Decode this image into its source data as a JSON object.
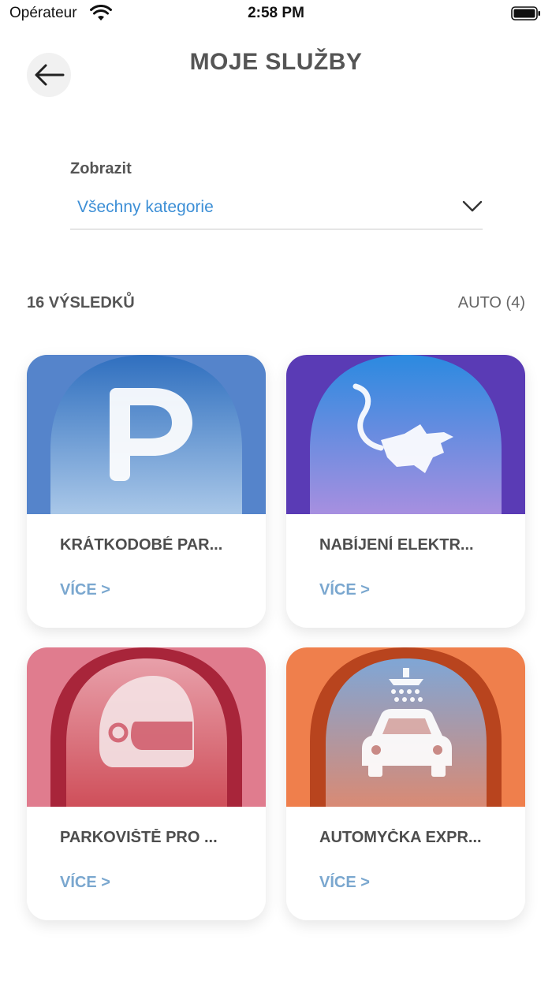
{
  "status": {
    "carrier": "Opérateur",
    "time": "2:58 PM"
  },
  "header": {
    "title": "MOJE SLUŽBY"
  },
  "filter": {
    "label": "Zobrazit",
    "value": "Všechny kategorie"
  },
  "results": {
    "count": "16 VÝSLEDKŮ",
    "tag": "AUTO (4)"
  },
  "cards": [
    {
      "title": "KRÁTKODOBÉ PAR...",
      "more": "VÍCE >",
      "icon": "parking-icon",
      "frame_color": "#3a6fc0",
      "sky_top": "#2f6fbf",
      "sky_bottom": "#a9c7e8"
    },
    {
      "title": "NABÍJENÍ ELEKTR...",
      "more": "VÍCE >",
      "icon": "ev-charging-icon",
      "frame_color": "#5a3bb5",
      "sky_top": "#2b8ae0",
      "sky_bottom": "#a78fe0"
    },
    {
      "title": "PARKOVIŠTĚ PRO ...",
      "more": "VÍCE >",
      "icon": "motorcycle-helmet-icon",
      "frame_color": "#a8253a",
      "sky_top": "#e07c8e",
      "sky_bottom": "#c93e4d"
    },
    {
      "title": "AUTOMYČKA EXPR...",
      "more": "VÍCE >",
      "icon": "car-wash-icon",
      "frame_color": "#b8441e",
      "sky_top": "#7fa6d6",
      "sky_bottom": "#d98a74"
    }
  ]
}
